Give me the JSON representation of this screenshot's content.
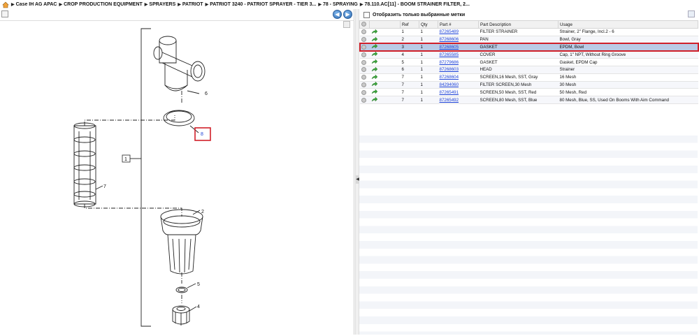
{
  "breadcrumb": {
    "items": [
      "Case IH AG APAC",
      "CROP PRODUCTION EQUIPMENT",
      "SPRAYERS",
      "PATRIOT",
      "PATRIOT 3240 - PATRIOT SPRAYER - TIER 3...",
      "78 - SPRAYING",
      "78.110.AC[11] - BOOM STRAINER FILTER, 2..."
    ]
  },
  "drawing": {
    "callouts": [
      "6",
      "8",
      "1",
      "7",
      "2",
      "5",
      "4"
    ]
  },
  "filter": {
    "label": "Отобразить только выбранные метки"
  },
  "table": {
    "headers": [
      "Ref",
      "Qty",
      "Part #",
      "Part Description",
      "Usage"
    ],
    "rows": [
      {
        "ref": "1",
        "qty": "1",
        "part": "87265489",
        "desc": "FILTER STRAINER",
        "usage": "Strainer, 2\" Flange, Incl.2 - 6"
      },
      {
        "ref": "2",
        "qty": "1",
        "part": "87268606",
        "desc": "PAN",
        "usage": "Bowl, Gray"
      },
      {
        "ref": "3",
        "qty": "1",
        "part": "87268605",
        "desc": "GASKET",
        "usage": "EPDM, Bowl"
      },
      {
        "ref": "4",
        "qty": "1",
        "part": "87265585",
        "desc": "COVER",
        "usage": "Cap, 1\" NPT, Without Ring Groove"
      },
      {
        "ref": "5",
        "qty": "1",
        "part": "87279686",
        "desc": "GASKET",
        "usage": "Gasket, EPDM Cap"
      },
      {
        "ref": "6",
        "qty": "1",
        "part": "87268603",
        "desc": "HEAD",
        "usage": "Strainer"
      },
      {
        "ref": "7",
        "qty": "1",
        "part": "87268604",
        "desc": "SCREEN,16 Mesh, SST, Gray",
        "usage": "16 Mesh"
      },
      {
        "ref": "7",
        "qty": "1",
        "part": "84294060",
        "desc": "FILTER SCREEN,30 Mesh",
        "usage": "30 Mesh"
      },
      {
        "ref": "7",
        "qty": "1",
        "part": "87265491",
        "desc": "SCREEN,50 Mesh, SST, Red",
        "usage": "50 Mesh, Red"
      },
      {
        "ref": "7",
        "qty": "1",
        "part": "87265492",
        "desc": "SCREEN,80 Mesh, SST, Blue",
        "usage": "80 Mesh, Blue, SS, Used On Booms With Aim Command"
      }
    ],
    "selected_row_index": 2
  },
  "colors": {
    "highlight": "#d0202a",
    "link": "#1a3fd6",
    "selected_row": "#b9cbe6"
  }
}
